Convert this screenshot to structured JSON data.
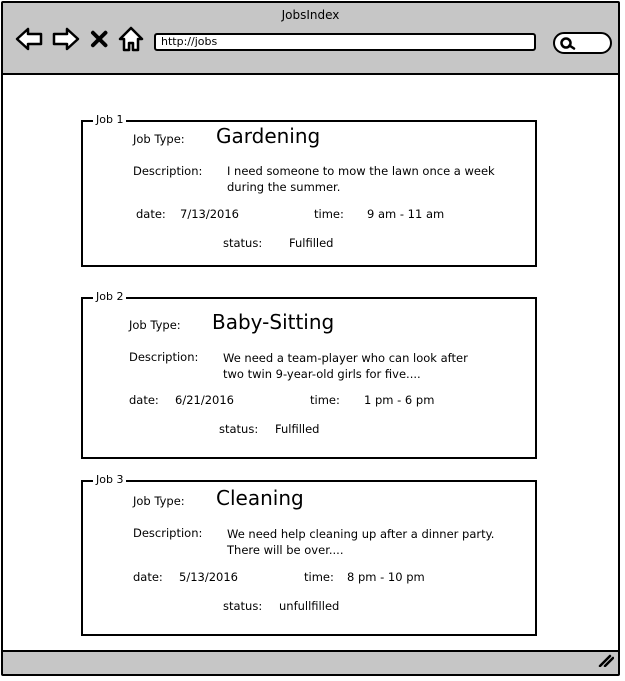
{
  "window": {
    "title": "JobsIndex"
  },
  "toolbar": {
    "back_icon": "arrow-left-icon",
    "forward_icon": "arrow-right-icon",
    "stop_icon": "close-icon",
    "home_icon": "home-icon",
    "search_icon": "search-icon"
  },
  "address_bar": {
    "url": "http://jobs"
  },
  "labels": {
    "job_type": "Job Type:",
    "description": "Description:",
    "date": "date:",
    "time": "time:",
    "status": "status:"
  },
  "jobs": [
    {
      "legend": "Job 1",
      "type": "Gardening",
      "description_line1": "I need someone to mow the lawn once a week",
      "description_line2": "during the summer.",
      "date": "7/13/2016",
      "time": "9 am - 11 am",
      "status": "Fulfilled"
    },
    {
      "legend": "Job 2",
      "type": "Baby-Sitting",
      "description_line1": "We need a team-player who can look after",
      "description_line2": "two twin 9-year-old girls for five....",
      "date": "6/21/2016",
      "time": "1 pm - 6 pm",
      "status": "Fulfilled"
    },
    {
      "legend": "Job 3",
      "type": "Cleaning",
      "description_line1": "We need help cleaning up after a dinner party.",
      "description_line2": "There will be over....",
      "date": "5/13/2016",
      "time": "8 pm - 10 pm",
      "status": "unfullfilled"
    }
  ]
}
